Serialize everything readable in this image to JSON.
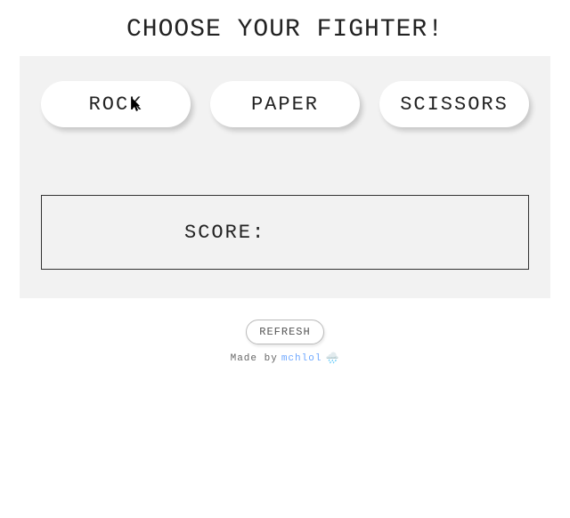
{
  "title": "CHOOSE YOUR FIGHTER!",
  "choices": {
    "rock": "ROCK",
    "paper": "PAPER",
    "scissors": "SCISSORS"
  },
  "score": {
    "label": "SCORE:",
    "value": ""
  },
  "footer": {
    "refresh": "REFRESH",
    "made_by": "Made by",
    "author": "mchlol",
    "icon_glyph": "🌧️"
  }
}
